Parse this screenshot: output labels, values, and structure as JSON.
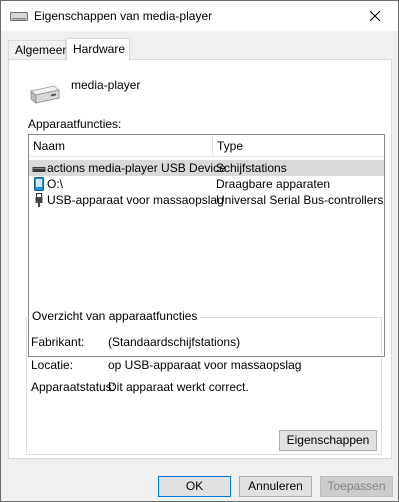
{
  "window": {
    "title": "Eigenschappen van media-player",
    "close_icon": "close-icon"
  },
  "tabs": [
    {
      "label": "Algemeen",
      "active": false
    },
    {
      "label": "Hardware",
      "active": true
    }
  ],
  "device": {
    "name": "media-player",
    "icon": "drive-icon"
  },
  "functions": {
    "label": "Apparaatfuncties:",
    "columns": {
      "name": "Naam",
      "type": "Type"
    },
    "rows": [
      {
        "name": "actions media-player USB Device",
        "type": "Schijfstations",
        "icon": "disk-drive-icon",
        "selected": true
      },
      {
        "name": "O:\\",
        "type": "Draagbare apparaten",
        "icon": "portable-device-icon",
        "selected": false
      },
      {
        "name": "USB-apparaat voor massaopslag",
        "type": "Universal Serial Bus-controllers",
        "icon": "usb-icon",
        "selected": false
      }
    ]
  },
  "summary": {
    "title": "Overzicht van apparaatfuncties",
    "manufacturer_label": "Fabrikant:",
    "manufacturer_value": "(Standaardschijfstations)",
    "location_label": "Locatie:",
    "location_value": "op USB-apparaat voor massaopslag",
    "status_label": "Apparaatstatus:",
    "status_value": "Dit apparaat werkt correct.",
    "properties_button": "Eigenschappen"
  },
  "footer": {
    "ok": "OK",
    "cancel": "Annuleren",
    "apply": "Toepassen"
  }
}
